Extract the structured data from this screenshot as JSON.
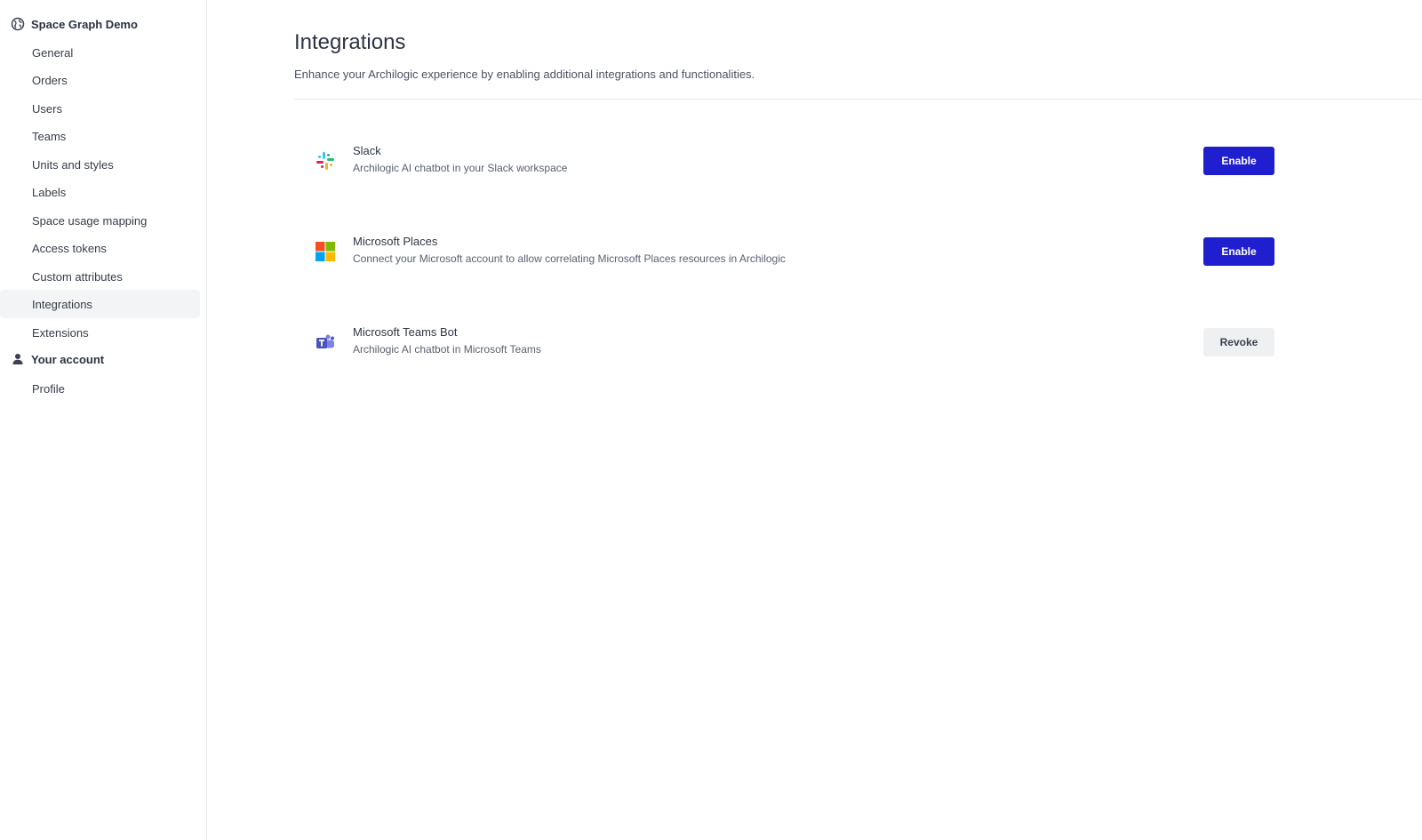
{
  "sidebar": {
    "org_title": "Space Graph Demo",
    "items": [
      {
        "label": "General"
      },
      {
        "label": "Orders"
      },
      {
        "label": "Users"
      },
      {
        "label": "Teams"
      },
      {
        "label": "Units and styles"
      },
      {
        "label": "Labels"
      },
      {
        "label": "Space usage mapping"
      },
      {
        "label": "Access tokens"
      },
      {
        "label": "Custom attributes"
      },
      {
        "label": "Integrations"
      },
      {
        "label": "Extensions"
      }
    ],
    "active_item": "Integrations",
    "account_title": "Your account",
    "account_items": [
      {
        "label": "Profile"
      }
    ]
  },
  "main": {
    "title": "Integrations",
    "subtitle": "Enhance your Archilogic experience by enabling additional integrations and functionalities.",
    "integrations": [
      {
        "name": "Slack",
        "description": "Archilogic AI chatbot in your Slack workspace",
        "action": "Enable",
        "icon": "slack-icon"
      },
      {
        "name": "Microsoft Places",
        "description": "Connect your Microsoft account to allow correlating Microsoft Places resources in Archilogic",
        "action": "Enable",
        "icon": "microsoft-icon"
      },
      {
        "name": "Microsoft Teams Bot",
        "description": "Archilogic AI chatbot in Microsoft Teams",
        "action": "Revoke",
        "icon": "teams-icon"
      }
    ]
  },
  "colors": {
    "primary_button": "#1f1fcf",
    "secondary_button": "#eef0f2",
    "active_nav_bg": "#f3f4f6"
  }
}
